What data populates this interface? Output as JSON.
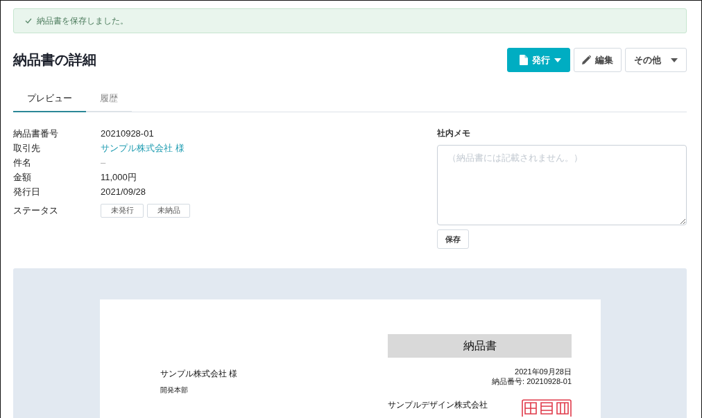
{
  "alert": {
    "text": "納品書を保存しました。"
  },
  "header": {
    "title": "納品書の詳細",
    "actions": [
      {
        "kind": "issue",
        "label": "発行",
        "dropdown": true
      },
      {
        "kind": "edit",
        "label": "編集",
        "dropdown": false
      },
      {
        "kind": "more",
        "label": "その他",
        "dropdown": true
      }
    ]
  },
  "tabs": [
    {
      "label": "プレビュー",
      "selected": true
    },
    {
      "label": "履歴",
      "selected": false
    }
  ],
  "details": [
    {
      "label": "納品書番号",
      "kind": "text",
      "value": "20210928-01"
    },
    {
      "label": "取引先",
      "kind": "link",
      "value": "サンプル株式会社 様"
    },
    {
      "label": "件名",
      "kind": "empty",
      "value": "–"
    },
    {
      "label": "金額",
      "kind": "text",
      "value": "11,000円"
    },
    {
      "label": "発行日",
      "kind": "text",
      "value": "2021/09/28"
    },
    {
      "label": "ステータス",
      "kind": "badges",
      "badges": [
        "未発行",
        "未納品"
      ]
    }
  ],
  "memo": {
    "label": "社内メモ",
    "placeholder": "（納品書には記載されません。）",
    "button": "保存"
  },
  "preview": {
    "document": {
      "title": "納品書",
      "recipient": "サンプル株式会社 様",
      "department": "開発本部",
      "date": "2021年09月28日",
      "number": "納品番号: 20210928-01",
      "issuer": "サンプルデザイン株式会社"
    }
  }
}
